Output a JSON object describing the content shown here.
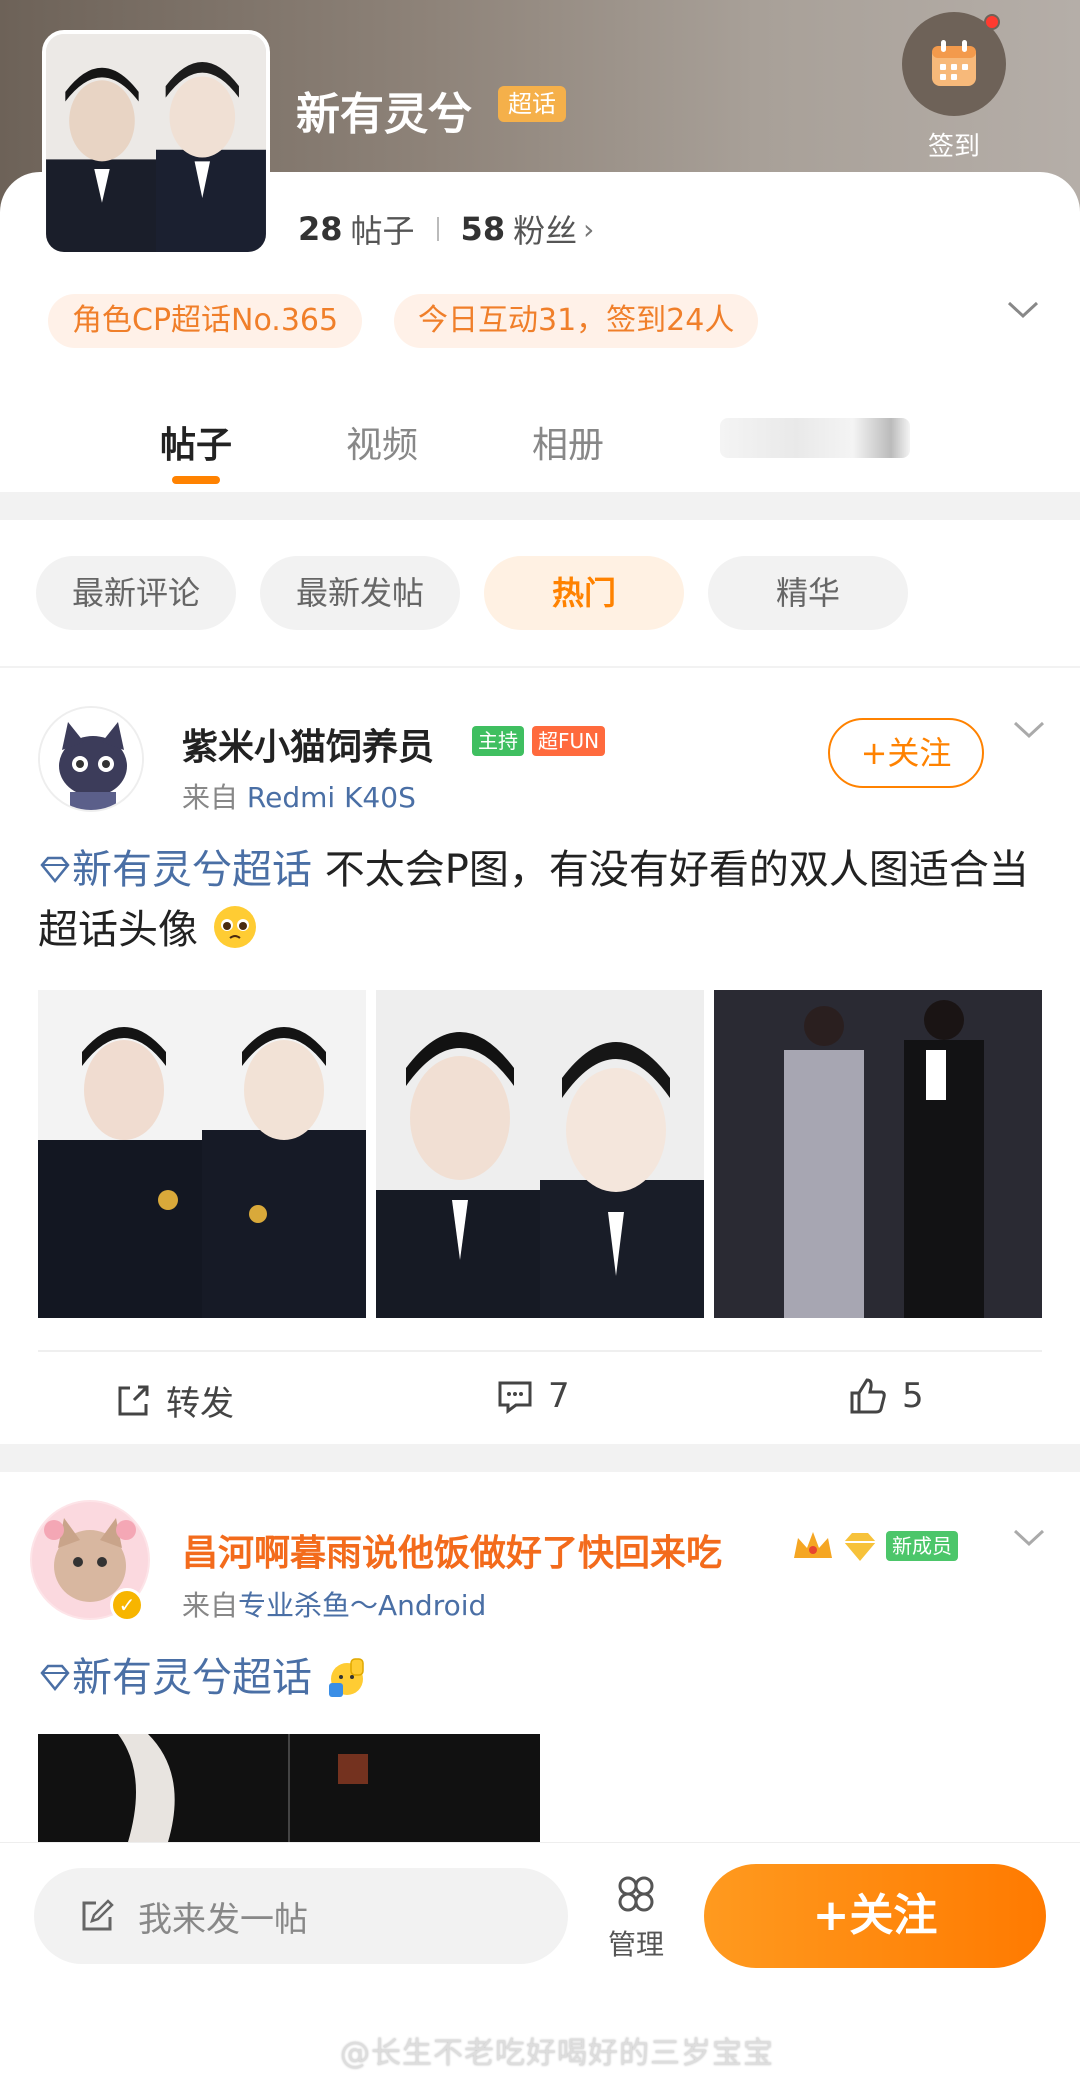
{
  "header": {
    "title": "新有灵兮",
    "title_badge": "超话",
    "checkin_label": "签到",
    "posts_count": "28",
    "posts_label": "帖子",
    "fans_count": "58",
    "fans_label": "粉丝"
  },
  "pills": [
    "角色CP超话No.365",
    "今日互动31，签到24人"
  ],
  "tabs": [
    "帖子",
    "视频",
    "相册"
  ],
  "filters": [
    "最新评论",
    "最新发帖",
    "热门",
    "精华"
  ],
  "post1": {
    "username": "紫米小猫饲养员",
    "badge_host": "主持",
    "badge_fun": "超FUN",
    "source_prefix": "来自",
    "source": "Redmi K40S",
    "follow_label": "+关注",
    "topic": "新有灵兮超话",
    "text": " 不太会P图，有没有好看的双人图适合当超话头像",
    "repost_label": "转发",
    "comment_count": "7",
    "like_count": "5"
  },
  "post2": {
    "username": "昌河啊暮雨说他饭做好了快回来吃",
    "badge_new": "新成员",
    "source_prefix": "来自",
    "source": "专业杀鱼～Android",
    "topic": "新有灵兮超话"
  },
  "bottom": {
    "compose_placeholder": "我来发一帖",
    "manage_label": "管理",
    "follow_label": "+关注"
  },
  "watermark": "@长生不老吃好喝好的三岁宝宝",
  "colors": {
    "accent": "#ff8200",
    "topic": "#4a6fa5",
    "pill_bg": "#fff1e8"
  }
}
